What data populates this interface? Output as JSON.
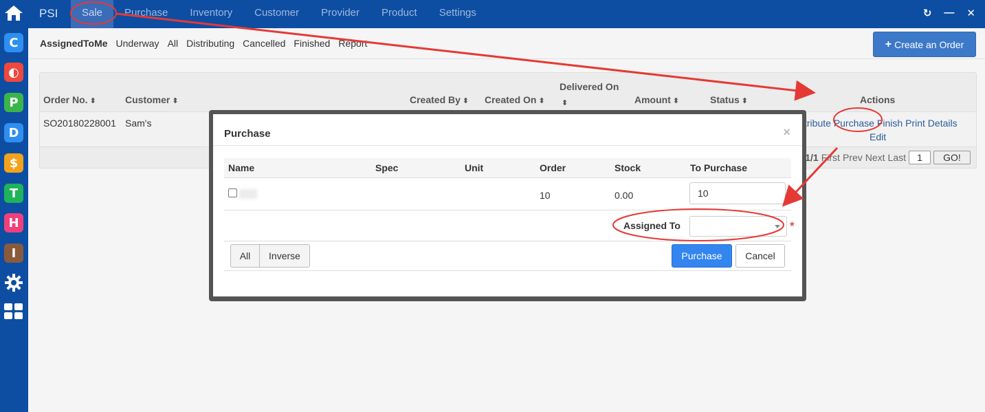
{
  "app": {
    "brand": "PSI"
  },
  "top_nav": {
    "items": [
      {
        "label": "Sale",
        "active": true
      },
      {
        "label": "Purchase",
        "active": false
      },
      {
        "label": "Inventory",
        "active": false
      },
      {
        "label": "Customer",
        "active": false
      },
      {
        "label": "Provider",
        "active": false
      },
      {
        "label": "Product",
        "active": false
      },
      {
        "label": "Settings",
        "active": false
      }
    ],
    "tools": [
      {
        "icon": "refresh-icon",
        "glyph": "↻"
      },
      {
        "icon": "minimize-icon",
        "glyph": "—"
      },
      {
        "icon": "close-icon",
        "glyph": "✕"
      }
    ]
  },
  "rail": {
    "items": [
      {
        "icon": "home-icon",
        "glyph": "⌂",
        "color": ""
      },
      {
        "icon": "app-c-icon",
        "glyph": "C",
        "color": "#2e8ff0"
      },
      {
        "icon": "app-o-icon",
        "glyph": "◐",
        "color": "#f0483e"
      },
      {
        "icon": "app-p-icon",
        "glyph": "P",
        "color": "#3bb54a"
      },
      {
        "icon": "app-d-icon",
        "glyph": "D",
        "color": "#2e8ff0"
      },
      {
        "icon": "app-s-icon",
        "glyph": "$",
        "color": "#f3a21c"
      },
      {
        "icon": "app-t-icon",
        "glyph": "T",
        "color": "#1fb35a"
      },
      {
        "icon": "app-h-icon",
        "glyph": "H",
        "color": "#f0407a"
      },
      {
        "icon": "app-i-icon",
        "glyph": "I",
        "color": "#8a5a3c"
      },
      {
        "icon": "settings-icon",
        "glyph": "⚙",
        "color": ""
      },
      {
        "icon": "grid-icon",
        "glyph": "▦",
        "color": ""
      }
    ]
  },
  "sub_nav": {
    "tabs": [
      {
        "label": "AssignedToMe",
        "active": true
      },
      {
        "label": "Underway",
        "active": false
      },
      {
        "label": "All",
        "active": false
      },
      {
        "label": "Distributing",
        "active": false
      },
      {
        "label": "Cancelled",
        "active": false
      },
      {
        "label": "Finished",
        "active": false
      },
      {
        "label": "Report",
        "active": false
      }
    ],
    "create_label": "Create an Order"
  },
  "orders_table": {
    "columns": {
      "order_no": "Order No.",
      "customer": "Customer",
      "created_by": "Created By",
      "created_on": "Created On",
      "delivered_on": "Delivered On",
      "amount": "Amount",
      "status": "Status",
      "actions": "Actions"
    },
    "rows": [
      {
        "order_no": "SO20180228001",
        "customer": "Sam's",
        "actions_partial": "stribute",
        "action_purchase": "Purchase",
        "action_finish": "Finish",
        "action_print": "Print",
        "action_details": "Details",
        "action_edit": "Edit"
      }
    ],
    "pager": {
      "page_info": "1/1",
      "first": "First",
      "prev": "Prev",
      "next": "Next",
      "last": "Last",
      "page_input": "1",
      "go": "GO!"
    }
  },
  "modal": {
    "title": "Purchase",
    "close_glyph": "×",
    "columns": {
      "name": "Name",
      "spec": "Spec",
      "unit": "Unit",
      "order": "Order",
      "stock": "Stock",
      "to_purchase": "To Purchase"
    },
    "row": {
      "order": "10",
      "stock": "0.00",
      "to_purchase": "10"
    },
    "assigned_label": "Assigned To",
    "required_mark": "*",
    "btn_all": "All",
    "btn_inverse": "Inverse",
    "btn_purchase": "Purchase",
    "btn_cancel": "Cancel"
  },
  "colors": {
    "nav_bg": "#0d4ea3",
    "primary": "#3385f0",
    "annotation": "#e53935"
  }
}
